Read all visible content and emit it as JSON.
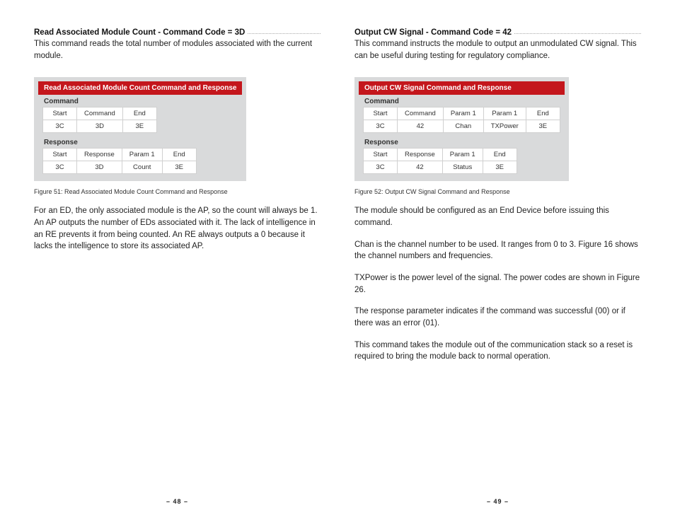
{
  "left": {
    "heading": "Read Associated Module Count - Command Code = 3D",
    "intro": "This command reads the total number of modules associated with the current module.",
    "table_title": "Read Associated Module Count Command and Response",
    "cmd_label": "Command",
    "cmd_headers": [
      "Start",
      "Command",
      "End"
    ],
    "cmd_values": [
      "3C",
      "3D",
      "3E"
    ],
    "resp_label": "Response",
    "resp_headers": [
      "Start",
      "Response",
      "Param 1",
      "End"
    ],
    "resp_values": [
      "3C",
      "3D",
      "Count",
      "3E"
    ],
    "caption": "Figure 51: Read Associated Module Count Command and Response",
    "p1": "For an ED, the only associated module is the AP, so the count will always be 1. An AP outputs the number of EDs associated with it. The lack of intelligence in an RE prevents it from being counted. An RE always outputs a 0 because it lacks the intelligence to store its associated AP.",
    "page": "– 48 –"
  },
  "right": {
    "heading": "Output CW Signal - Command Code = 42",
    "intro": "This command instructs the module to output an unmodulated CW signal. This can be useful during testing for regulatory compliance.",
    "table_title": "Output CW Signal Command and Response",
    "cmd_label": "Command",
    "cmd_headers": [
      "Start",
      "Command",
      "Param 1",
      "Param 1",
      "End"
    ],
    "cmd_values": [
      "3C",
      "42",
      "Chan",
      "TXPower",
      "3E"
    ],
    "resp_label": "Response",
    "resp_headers": [
      "Start",
      "Response",
      "Param 1",
      "End"
    ],
    "resp_values": [
      "3C",
      "42",
      "Status",
      "3E"
    ],
    "caption": "Figure 52: Output CW Signal Command and Response",
    "p1": "The module should be configured as an End Device before issuing this command.",
    "p2": "Chan is the channel number to be used. It ranges from 0 to 3. Figure 16 shows the channel numbers and frequencies.",
    "p3": "TXPower is the power level of the signal. The power codes are shown in Figure 26.",
    "p4": "The response parameter indicates if the command was successful (00) or if there was an error (01).",
    "p5": "This command takes the module out of the communication stack so a reset is required to bring the module back to normal operation.",
    "page": "– 49 –"
  }
}
